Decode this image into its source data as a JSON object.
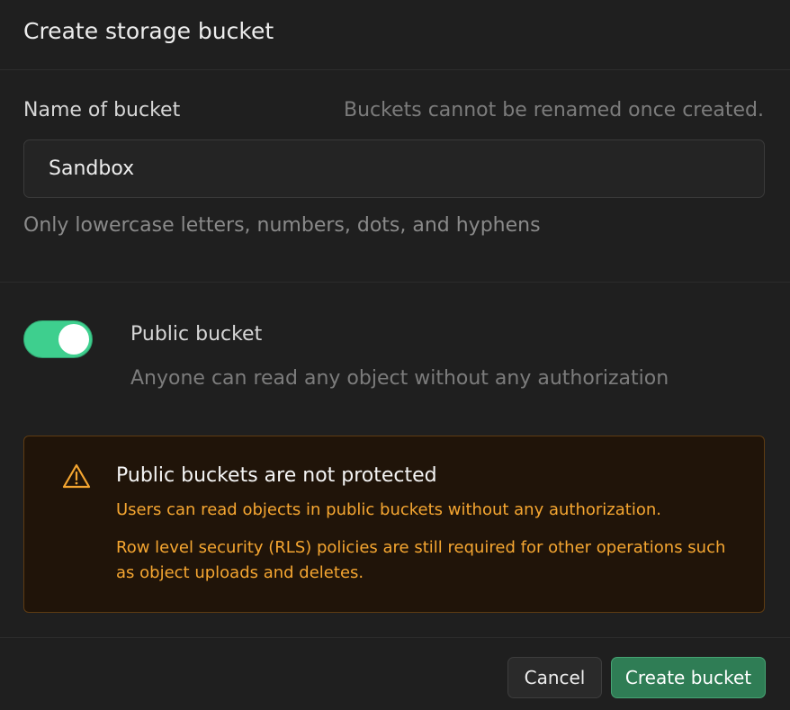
{
  "dialog": {
    "title": "Create storage bucket"
  },
  "name_field": {
    "label": "Name of bucket",
    "note": "Buckets cannot be renamed once created.",
    "value": "Sandbox",
    "help": "Only lowercase letters, numbers, dots, and hyphens"
  },
  "public_toggle": {
    "label": "Public bucket",
    "description": "Anyone can read any object without any authorization",
    "checked": true
  },
  "warning": {
    "icon": "alert-triangle-icon",
    "title": "Public buckets are not protected",
    "text_1": "Users can read objects in public buckets without any authorization.",
    "text_2": "Row level security (RLS) policies are still required for other operations such as object uploads and deletes."
  },
  "footer": {
    "cancel_label": "Cancel",
    "create_label": "Create bucket"
  },
  "colors": {
    "toggle_on": "#3ecf8e",
    "warning_text": "#f5a631",
    "primary_button": "#2f7d55"
  }
}
